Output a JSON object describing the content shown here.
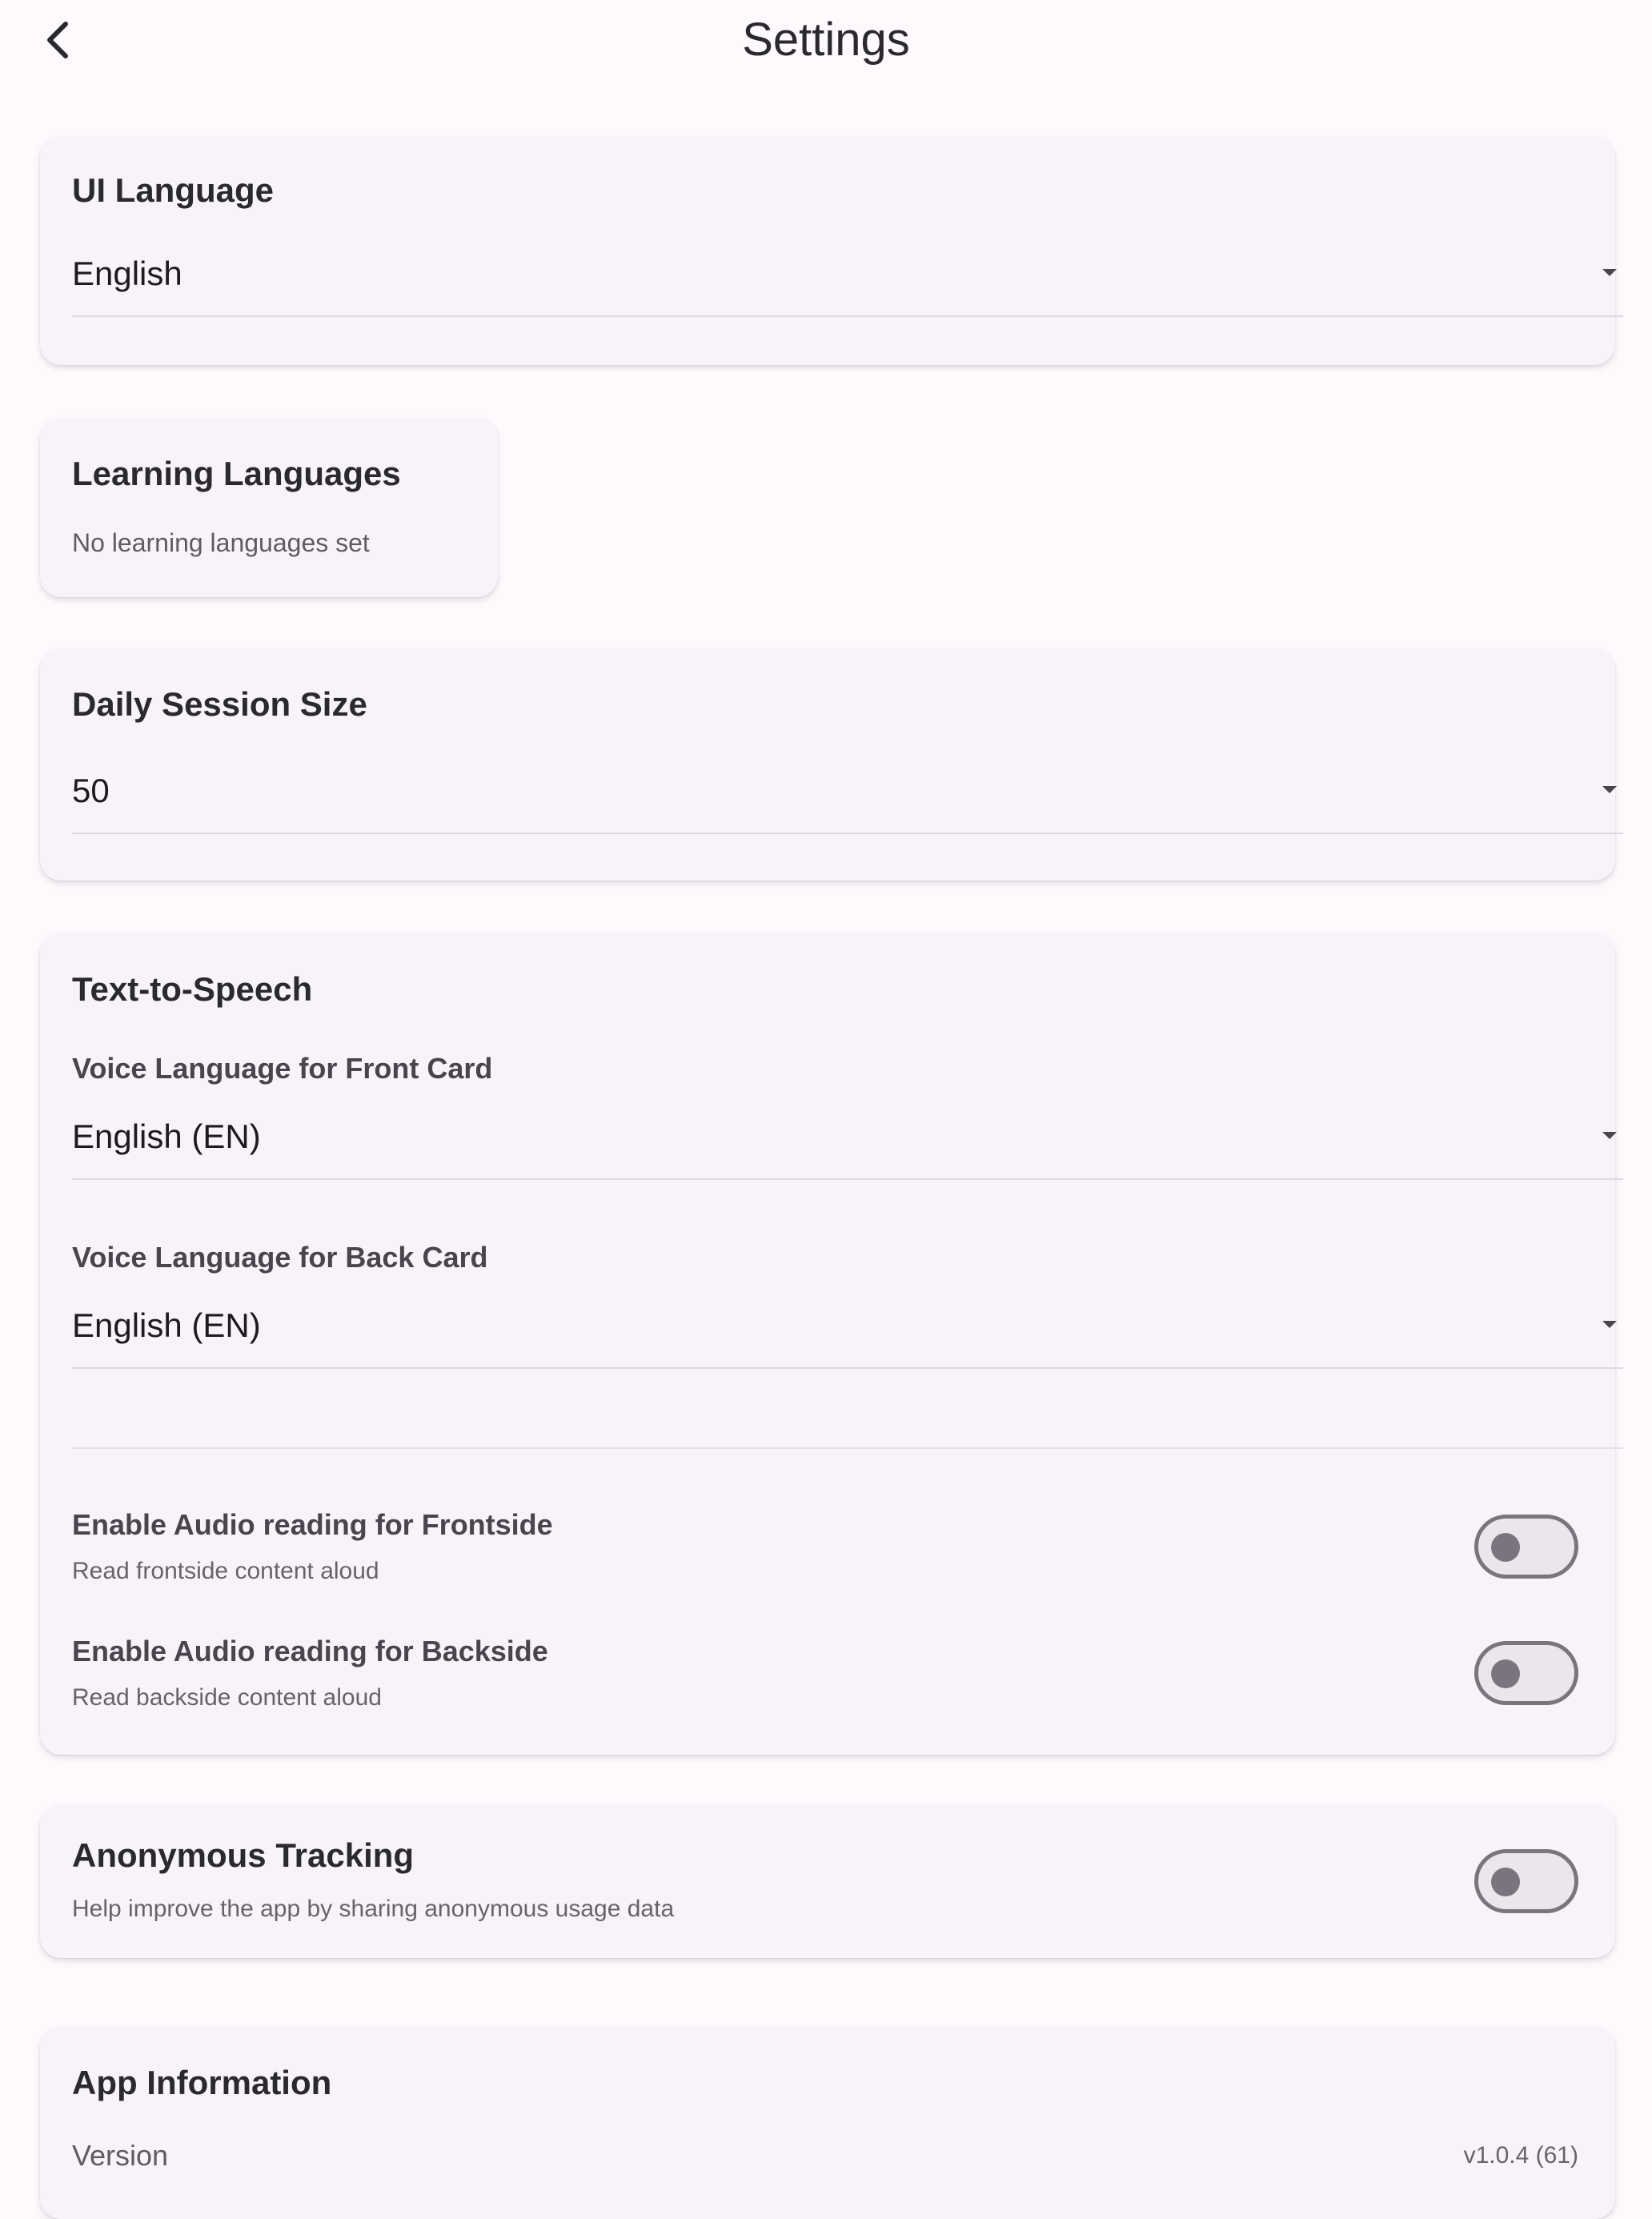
{
  "header": {
    "title": "Settings",
    "back_icon": "chevron-left-icon"
  },
  "ui_language": {
    "title": "UI Language",
    "value": "English"
  },
  "learning_languages": {
    "title": "Learning Languages",
    "subtitle": "No learning languages set"
  },
  "daily_session": {
    "title": "Daily Session Size",
    "value": "50"
  },
  "tts": {
    "title": "Text-to-Speech",
    "front_label": "Voice Language for Front Card",
    "front_value": "English (EN)",
    "back_label": "Voice Language for Back Card",
    "back_value": "English (EN)",
    "front_audio_title": "Enable Audio reading for Frontside",
    "front_audio_sub": "Read frontside content aloud",
    "front_audio_enabled": false,
    "back_audio_title": "Enable Audio reading for Backside",
    "back_audio_sub": "Read backside content aloud",
    "back_audio_enabled": false
  },
  "tracking": {
    "title": "Anonymous Tracking",
    "subtitle": "Help improve the app by sharing anonymous usage data",
    "enabled": false
  },
  "app_info": {
    "title": "App Information",
    "version_label": "Version",
    "version_value": "v1.0.4 (61)"
  }
}
